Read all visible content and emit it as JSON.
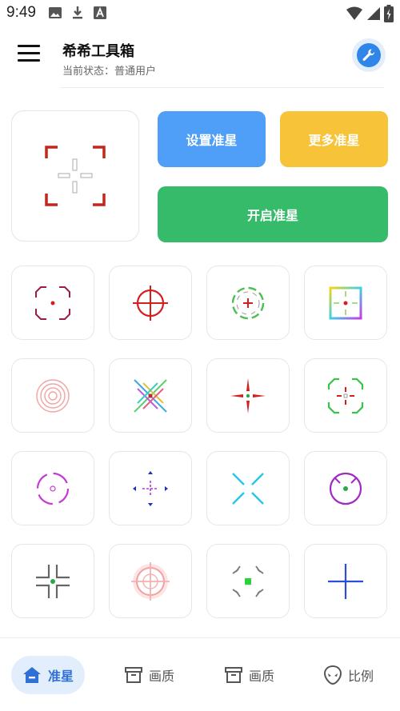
{
  "status_bar": {
    "time": "9:49"
  },
  "header": {
    "title": "希希工具箱",
    "status_text": "当前状态：普通用户"
  },
  "buttons": {
    "set_crosshair": "设置准星",
    "more_crosshair": "更多准星",
    "open_crosshair": "开启准星"
  },
  "colors": {
    "accent_blue": "#4f9ef8",
    "accent_yellow": "#f6c339",
    "accent_green": "#36bb6b",
    "preview_red": "#c0281e",
    "nav_active_bg": "#e3eefc",
    "nav_active_text": "#2f6fd6"
  },
  "crosshair_tiles": [
    {
      "icon": "octagon-crosshair-icon"
    },
    {
      "icon": "circle-scope-crosshair-icon"
    },
    {
      "icon": "dashed-circle-plus-crosshair-icon"
    },
    {
      "icon": "rainbow-square-crosshair-icon"
    },
    {
      "icon": "concentric-rings-crosshair-icon"
    },
    {
      "icon": "rainbow-x-crosshair-icon"
    },
    {
      "icon": "red-spike-crosshair-icon"
    },
    {
      "icon": "green-octagon-crosshair-icon"
    },
    {
      "icon": "purple-arc-crosshair-icon"
    },
    {
      "icon": "blue-diamond-crosshair-icon"
    },
    {
      "icon": "cyan-x-crosshair-icon"
    },
    {
      "icon": "purple-circle-crosshair-icon"
    },
    {
      "icon": "gray-gap-crosshair-icon"
    },
    {
      "icon": "glow-target-crosshair-icon"
    },
    {
      "icon": "corner-brackets-crosshair-icon"
    },
    {
      "icon": "blue-plus-crosshair-icon"
    }
  ],
  "bottom_nav": [
    {
      "label": "准星",
      "icon": "home-icon",
      "active": true
    },
    {
      "label": "画质",
      "icon": "archive-box-icon",
      "active": false
    },
    {
      "label": "画质",
      "icon": "archive-box-icon",
      "active": false
    },
    {
      "label": "比例",
      "icon": "alien-icon",
      "active": false
    }
  ]
}
